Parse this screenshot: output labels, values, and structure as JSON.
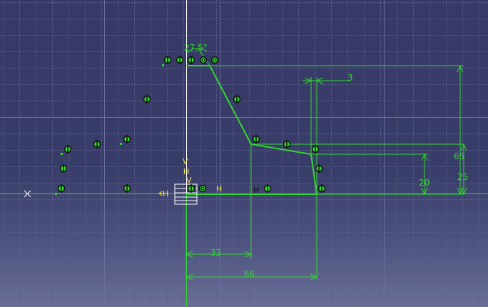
{
  "colors": {
    "background_top": "#373a66",
    "background_bottom": "#6b6f97",
    "grid": "#5b5f8f",
    "profile": "#33d52f",
    "axis_v": "#ffffff",
    "axis_h": "#33d52f",
    "constraint_yellow": "#f2e341",
    "symbol_black": "#101010"
  },
  "dimensions": {
    "angle": "27.5°",
    "width_3": "3",
    "height_65": "65",
    "height_25": "25",
    "height_20": "20",
    "length_33": "33",
    "length_66": "66"
  },
  "constraints": {
    "h_left": "H",
    "h_axis": "H",
    "h_mid": "H",
    "v_axis": "V",
    "h_stack": "H",
    "v_stack": "V"
  },
  "icons": {
    "origin_marker": "x-mark-icon",
    "tangency": "tangency-symbol-icon",
    "coincidence": "coincidence-symbol-icon",
    "axis_box": "sketch-axis-box-icon"
  }
}
